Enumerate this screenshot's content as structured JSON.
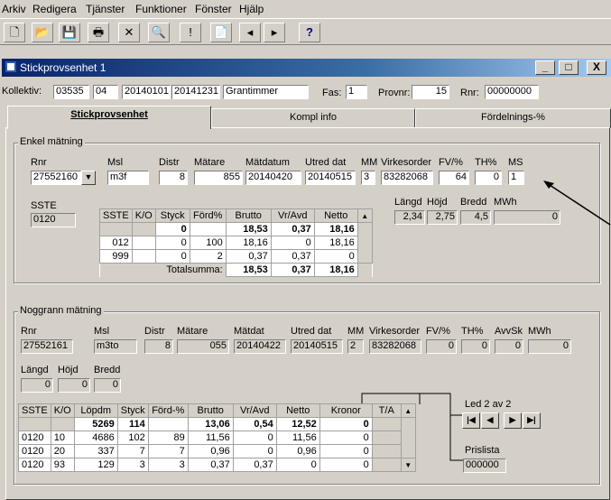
{
  "menu": [
    "Arkiv",
    "Redigera",
    "Tjänster",
    "Funktioner",
    "Fönster",
    "Hjälp"
  ],
  "toolbar_icons": [
    "new-icon",
    "open-icon",
    "save-icon",
    "print-icon",
    "delete-icon",
    "find-icon",
    "alert-icon",
    "copy-icon",
    "prev-icon",
    "next-icon",
    "help-icon"
  ],
  "toolbar_glyphs": [
    "🗋",
    "📂",
    "💾",
    "🖶",
    "✕",
    "🔍",
    "!",
    "📄",
    "◂",
    "▸",
    "?"
  ],
  "window": {
    "title": "Stickprovsenhet 1",
    "min": "_",
    "max": "□",
    "close": "X"
  },
  "header": {
    "kollektiv_label": "Kollektiv:",
    "kollektiv_values": [
      "03535",
      "04",
      "20140101",
      "20141231",
      "Grantimmer"
    ],
    "fas_label": "Fas:",
    "fas_value": "1",
    "provnr_label": "Provnr:",
    "provnr_value": "15",
    "rnr_label": "Rnr:",
    "rnr_value": "00000000"
  },
  "tabs": [
    "Stickprovsenhet",
    "Kompl info",
    "Fördelnings-%"
  ],
  "enkel": {
    "title": "Enkel mätning",
    "labels": {
      "rnr": "Rnr",
      "msl": "Msl",
      "distr": "Distr",
      "matare": "Mätare",
      "matdatum": "Mätdatum",
      "utred": "Utred dat",
      "mm": "MM",
      "virkesorder": "Virkesorder",
      "fv": "FV/%",
      "th": "TH%",
      "ms": "MS"
    },
    "values": {
      "rnr": "27552160",
      "msl": "m3f",
      "distr": "8",
      "matare": "855",
      "matdatum": "20140420",
      "utred": "20140515",
      "mm": "3",
      "virkesorder": "83282068",
      "fv": "64",
      "th": "0",
      "ms": "1"
    },
    "sste_label": "SSTE",
    "sste_value": "0120",
    "dim_labels": {
      "langd": "Längd",
      "hojd": "Höjd",
      "bredd": "Bredd",
      "mwh": "MWh"
    },
    "dim_values": {
      "langd": "2,34",
      "hojd": "2,75",
      "bredd": "4,5",
      "mwh": "0"
    },
    "grid": {
      "columns": [
        "SSTE",
        "K/O",
        "Styck",
        "Förd%",
        "Brutto",
        "Vr/Avd",
        "Netto"
      ],
      "rows": [
        [
          "",
          "",
          "0",
          "",
          "18,53",
          "0,37",
          "18,16"
        ],
        [
          "012",
          "",
          "0",
          "100",
          "18,16",
          "0",
          "18,16"
        ],
        [
          "999",
          "",
          "0",
          "2",
          "0,37",
          "0,37",
          "0"
        ]
      ],
      "total_label": "Totalsumma:",
      "totals": [
        "18,53",
        "0,37",
        "18,16"
      ]
    }
  },
  "noggrann": {
    "title": "Noggrann mätning",
    "labels": {
      "rnr": "Rnr",
      "msl": "Msl",
      "distr": "Distr",
      "matare": "Mätare",
      "matdat": "Mätdat",
      "utred": "Utred dat",
      "mm": "MM",
      "virkesorder": "Virkesorder",
      "fv": "FV/%",
      "th": "TH%",
      "avvsk": "AvvSk",
      "mwh": "MWh"
    },
    "values": {
      "rnr": "27552161",
      "msl": "m3to",
      "distr": "8",
      "matare": "055",
      "matdat": "20140422",
      "utred": "20140515",
      "mm": "2",
      "virkesorder": "83282068",
      "fv": "0",
      "th": "0",
      "avvsk": "0",
      "mwh": "0"
    },
    "dim_labels": {
      "langd": "Längd",
      "hojd": "Höjd",
      "bredd": "Bredd"
    },
    "dim_values": {
      "langd": "0",
      "hojd": "0",
      "bredd": "0"
    },
    "grid": {
      "columns": [
        "SSTE",
        "K/O",
        "Löpdm",
        "Styck",
        "Förd-%",
        "Brutto",
        "Vr/Avd",
        "Netto",
        "Kronor",
        "T/A"
      ],
      "rows": [
        [
          "",
          "",
          "5269",
          "114",
          "",
          "13,06",
          "0,54",
          "12,52",
          "0",
          ""
        ],
        [
          "0120",
          "10",
          "4686",
          "102",
          "89",
          "11,56",
          "0",
          "11,56",
          "0",
          ""
        ],
        [
          "0120",
          "20",
          "337",
          "7",
          "7",
          "0,96",
          "0",
          "0,96",
          "0",
          ""
        ],
        [
          "0120",
          "93",
          "129",
          "3",
          "3",
          "0,37",
          "0,37",
          "0",
          "0",
          ""
        ]
      ]
    },
    "led_label": "Led 2 av 2",
    "nav_glyphs": [
      "|◀",
      "◀",
      "▶",
      "▶|"
    ],
    "prislista_label": "Prislista",
    "prislista_value": "000000"
  }
}
